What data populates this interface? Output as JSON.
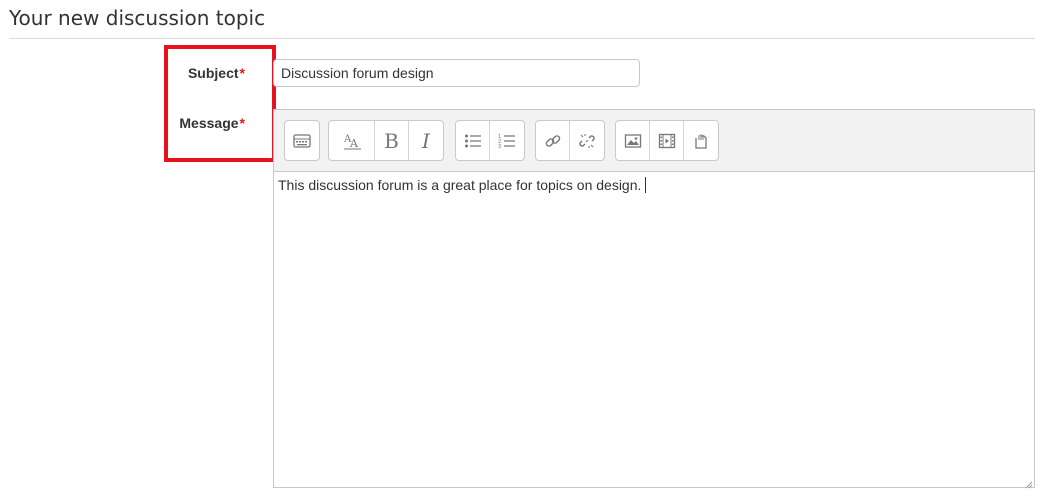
{
  "page": {
    "title": "Your new discussion topic"
  },
  "form": {
    "subject_label": "Subject",
    "message_label": "Message",
    "required_mark": "*",
    "subject_value": "Discussion forum design",
    "message_value": "This discussion forum is a great place for topics on design."
  },
  "toolbar": {
    "groups": [
      [
        "toolbar-toggle-icon"
      ],
      [
        "font-size-icon",
        "bold-icon",
        "italic-icon"
      ],
      [
        "unordered-list-icon",
        "ordered-list-icon"
      ],
      [
        "link-icon",
        "unlink-icon"
      ],
      [
        "image-icon",
        "media-icon",
        "file-manage-icon"
      ]
    ],
    "bold_glyph": "B",
    "italic_glyph": "I"
  },
  "colors": {
    "required": "#e21a1a",
    "highlight_border": "#e8121e",
    "toolbar_bg": "#f2f2f2"
  }
}
